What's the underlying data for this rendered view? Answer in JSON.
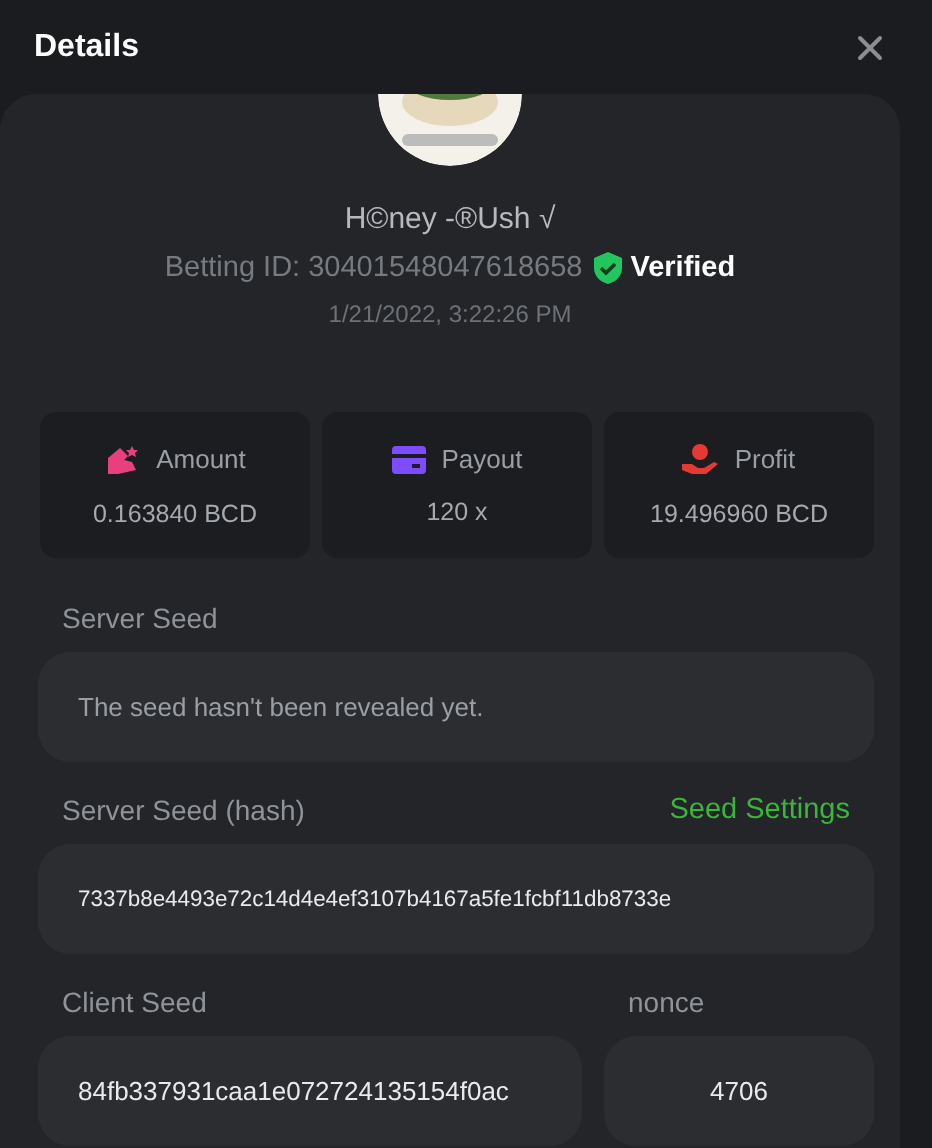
{
  "window": {
    "title": "Details"
  },
  "user": {
    "name": "H©ney -®Ush √",
    "betting_id": "Betting ID: 30401548047618658",
    "verified_label": "Verified",
    "time": "1/21/2022, 3:22:26 PM"
  },
  "stats": [
    {
      "kind": "amount",
      "label": "Amount",
      "value": "0.163840 BCD",
      "color": "#e8407e"
    },
    {
      "kind": "payout",
      "label": "Payout",
      "value": "120 x",
      "color": "#7c4dff"
    },
    {
      "kind": "profit",
      "label": "Profit",
      "value": "19.496960 BCD",
      "color": "#e53935"
    }
  ],
  "server_seed": {
    "label": "Server Seed",
    "value": "The seed hasn't been revealed yet."
  },
  "server_seed_hash": {
    "label": "Server Seed (hash)",
    "link": "Seed Settings",
    "value": "7337b8e4493e72c14d4e4ef3107b4167a5fe1fcbf11db8733e"
  },
  "client_seed": {
    "label": "Client Seed",
    "value": "84fb337931caa1e072724135154f0ac"
  },
  "nonce": {
    "label": "nonce",
    "value": "4706"
  }
}
